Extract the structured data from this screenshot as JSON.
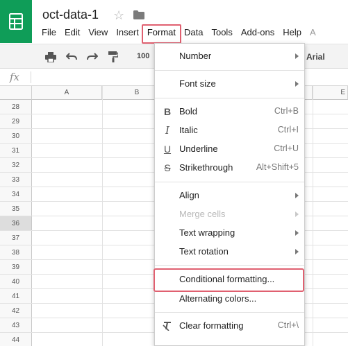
{
  "document": {
    "title": "oct-data-1"
  },
  "menubar": {
    "items": [
      {
        "label": "File"
      },
      {
        "label": "Edit"
      },
      {
        "label": "View"
      },
      {
        "label": "Insert"
      },
      {
        "label": "Format"
      },
      {
        "label": "Data"
      },
      {
        "label": "Tools"
      },
      {
        "label": "Add-ons"
      },
      {
        "label": "Help"
      },
      {
        "label": "A"
      }
    ]
  },
  "toolbar": {
    "zoom": "100",
    "font": "Arial"
  },
  "formula_bar": {
    "fx": "fx"
  },
  "grid": {
    "columns": [
      "A",
      "B",
      "",
      "",
      "E"
    ],
    "rows": [
      "28",
      "29",
      "30",
      "31",
      "32",
      "33",
      "34",
      "35",
      "36",
      "37",
      "38",
      "39",
      "40",
      "41",
      "42",
      "43",
      "44"
    ]
  },
  "format_menu": {
    "number": "Number",
    "font_size": "Font size",
    "bold": {
      "label": "Bold",
      "shortcut": "Ctrl+B"
    },
    "italic": {
      "label": "Italic",
      "shortcut": "Ctrl+I"
    },
    "underline": {
      "label": "Underline",
      "shortcut": "Ctrl+U"
    },
    "strikethrough": {
      "label": "Strikethrough",
      "shortcut": "Alt+Shift+5"
    },
    "align": "Align",
    "merge_cells": "Merge cells",
    "text_wrapping": "Text wrapping",
    "text_rotation": "Text rotation",
    "conditional_formatting": "Conditional formatting...",
    "alternating_colors": "Alternating colors...",
    "clear_formatting": {
      "label": "Clear formatting",
      "shortcut": "Ctrl+\\"
    }
  },
  "colors": {
    "brand_green": "#0f9d58",
    "highlight": "#e06070"
  }
}
